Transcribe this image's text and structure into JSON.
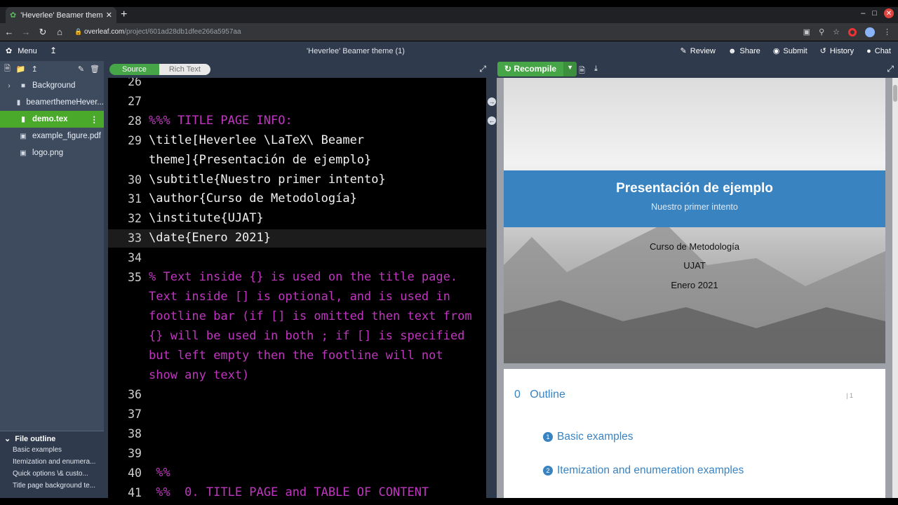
{
  "browser": {
    "tab_title": "'Heverlee' Beamer theme",
    "url_host": "overleaf.com",
    "url_path": "/project/601ad28db1dfee266a5957aa"
  },
  "overleaf": {
    "menu_label": "Menu",
    "project_title": "'Heverlee' Beamer theme (1)",
    "actions": [
      "Review",
      "Share",
      "Submit",
      "History",
      "Chat"
    ]
  },
  "file_tree": {
    "items": [
      {
        "label": "Background",
        "type": "folder"
      },
      {
        "label": "beamerthemeHever...",
        "type": "file"
      },
      {
        "label": "demo.tex",
        "type": "file",
        "selected": true
      },
      {
        "label": "example_figure.pdf",
        "type": "image"
      },
      {
        "label": "logo.png",
        "type": "image"
      }
    ]
  },
  "file_outline": {
    "title": "File outline",
    "items": [
      "Basic examples",
      "Itemization and enumera...",
      "Quick options \\& custo...",
      "Title page background te..."
    ]
  },
  "editor": {
    "source_label": "Source",
    "rich_text_label": "Rich Text",
    "lines": [
      {
        "num": "26",
        "text": ""
      },
      {
        "num": "27",
        "text": ""
      },
      {
        "num": "28",
        "text": "%%% TITLE PAGE INFO:",
        "comment": true
      },
      {
        "num": "29",
        "text": "\\title[Heverlee \\LaTeX\\ Beamer"
      },
      {
        "num": "",
        "text": "theme]{Presentación de ejemplo}"
      },
      {
        "num": "30",
        "text": "\\subtitle{Nuestro primer intento}"
      },
      {
        "num": "31",
        "text": "\\author{Curso de Metodología}"
      },
      {
        "num": "32",
        "text": "\\institute{UJAT}"
      },
      {
        "num": "33",
        "text": "\\date{Enero 2021}"
      },
      {
        "num": "34",
        "text": ""
      },
      {
        "num": "35",
        "text": "% Text inside {} is used on the title page.",
        "comment": true
      },
      {
        "num": "",
        "text": "Text inside [] is optional, and is used in",
        "comment": true
      },
      {
        "num": "",
        "text": "footline bar (if [] is omitted then text from",
        "comment": true
      },
      {
        "num": "",
        "text": "{} will be used in both ; if [] is specified",
        "comment": true
      },
      {
        "num": "",
        "text": "but left empty then the footline will not",
        "comment": true
      },
      {
        "num": "",
        "text": "show any text)",
        "comment": true
      },
      {
        "num": "36",
        "text": ""
      },
      {
        "num": "37",
        "text": ""
      },
      {
        "num": "38",
        "text": ""
      },
      {
        "num": "39",
        "text": ""
      },
      {
        "num": "40",
        "text": " %%",
        "comment": true
      },
      {
        "num": "41",
        "text": " %%  0. TITLE PAGE and TABLE OF CONTENT",
        "comment": true
      }
    ]
  },
  "pdf": {
    "recompile_label": "Recompile",
    "slide1": {
      "title": "Presentación de ejemplo",
      "subtitle": "Nuestro primer intento",
      "author": "Curso de Metodología",
      "institute": "UJAT",
      "date": "Enero 2021"
    },
    "slide2": {
      "section_num": "0",
      "section_title": "Outline",
      "page": "1",
      "items": [
        {
          "num": "1",
          "label": "Basic examples"
        },
        {
          "num": "2",
          "label": "Itemization and enumeration examples"
        }
      ]
    }
  },
  "colors": {
    "overleaf_dark": "#2f3a4c",
    "tree_bg": "#3e4b5e",
    "green": "#46a546",
    "beamer_blue": "#3a83c1",
    "comment": "#c036c0"
  }
}
